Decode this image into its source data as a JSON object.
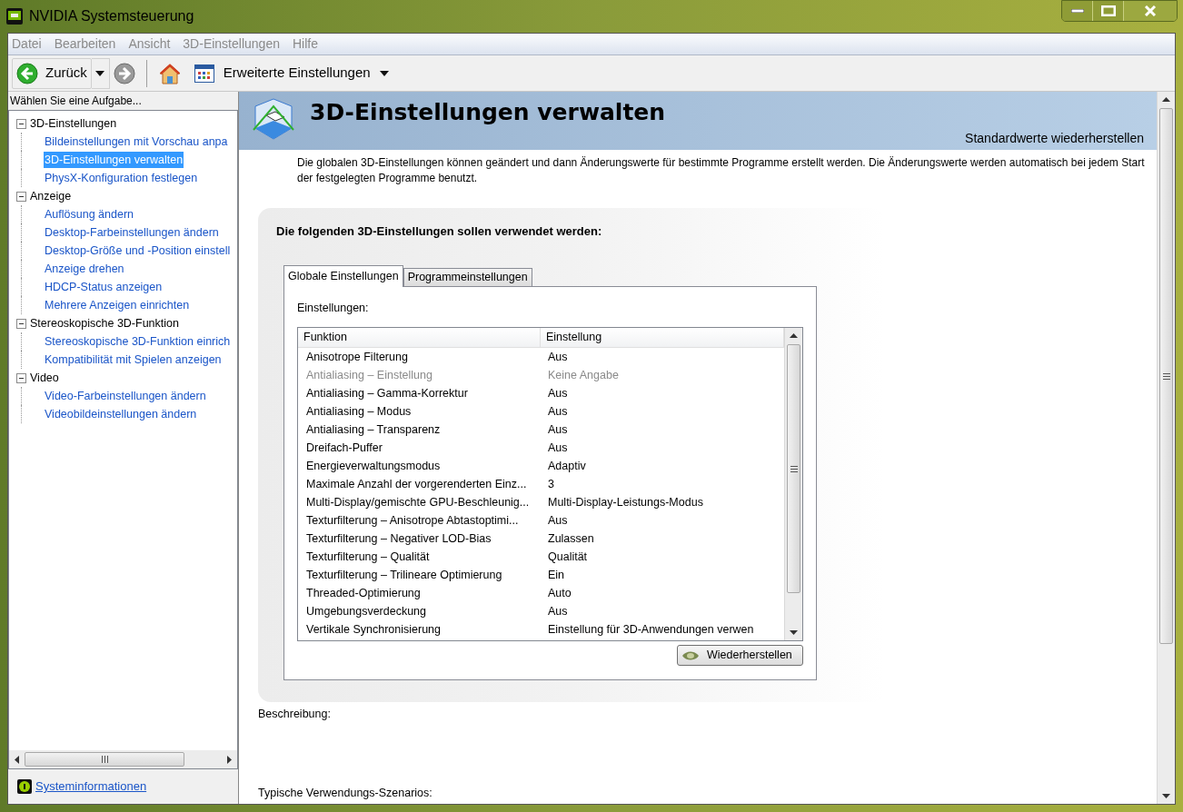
{
  "window": {
    "title": "NVIDIA Systemsteuerung"
  },
  "menu": [
    "Datei",
    "Bearbeiten",
    "Ansicht",
    "3D-Einstellungen",
    "Hilfe"
  ],
  "toolbar": {
    "back": "Zurück",
    "advanced": "Erweiterte Einstellungen"
  },
  "sidebar": {
    "heading": "Wählen Sie eine Aufgabe...",
    "tree": [
      {
        "label": "3D-Einstellungen",
        "expanded": true,
        "children": [
          {
            "label": "Bildeinstellungen mit Vorschau anpa",
            "selected": false
          },
          {
            "label": "3D-Einstellungen verwalten",
            "selected": true
          },
          {
            "label": "PhysX-Konfiguration festlegen",
            "selected": false
          }
        ]
      },
      {
        "label": "Anzeige",
        "expanded": true,
        "children": [
          {
            "label": "Auflösung ändern",
            "selected": false
          },
          {
            "label": "Desktop-Farbeinstellungen ändern",
            "selected": false
          },
          {
            "label": "Desktop-Größe und -Position einstell",
            "selected": false
          },
          {
            "label": "Anzeige drehen",
            "selected": false
          },
          {
            "label": "HDCP-Status anzeigen",
            "selected": false
          },
          {
            "label": "Mehrere Anzeigen einrichten",
            "selected": false
          }
        ]
      },
      {
        "label": "Stereoskopische 3D-Funktion",
        "expanded": true,
        "children": [
          {
            "label": "Stereoskopische 3D-Funktion einrich",
            "selected": false
          },
          {
            "label": "Kompatibilität mit Spielen anzeigen",
            "selected": false
          }
        ]
      },
      {
        "label": "Video",
        "expanded": true,
        "children": [
          {
            "label": "Video-Farbeinstellungen ändern",
            "selected": false
          },
          {
            "label": "Videobildeinstellungen ändern",
            "selected": false
          }
        ]
      }
    ],
    "footer_link": "Systeminformationen"
  },
  "content": {
    "title": "3D-Einstellungen verwalten",
    "restore_link": "Standardwerte wiederherstellen",
    "description": "Die globalen 3D-Einstellungen können geändert und dann Änderungswerte für bestimmte Programme erstellt werden. Die Änderungswerte werden automatisch bei jedem Start der festgelegten Programme benutzt.",
    "panel": {
      "heading": "Die folgenden 3D-Einstellungen sollen verwendet werden:",
      "tabs": [
        {
          "label": "Globale Einstellungen",
          "selected": true
        },
        {
          "label": "Programmeinstellungen",
          "selected": false
        }
      ],
      "settings_label": "Einstellungen:",
      "table": {
        "columns": [
          "Funktion",
          "Einstellung"
        ],
        "rows": [
          {
            "function": "Anisotrope Filterung",
            "setting": "Aus",
            "disabled": false
          },
          {
            "function": "Antialiasing – Einstellung",
            "setting": "Keine Angabe",
            "disabled": true
          },
          {
            "function": "Antialiasing – Gamma-Korrektur",
            "setting": "Aus",
            "disabled": false
          },
          {
            "function": "Antialiasing – Modus",
            "setting": "Aus",
            "disabled": false
          },
          {
            "function": "Antialiasing – Transparenz",
            "setting": "Aus",
            "disabled": false
          },
          {
            "function": "Dreifach-Puffer",
            "setting": "Aus",
            "disabled": false
          },
          {
            "function": "Energieverwaltungsmodus",
            "setting": "Adaptiv",
            "disabled": false
          },
          {
            "function": "Maximale Anzahl der vorgerenderten Einz...",
            "setting": "3",
            "disabled": false
          },
          {
            "function": "Multi-Display/gemischte GPU-Beschleunig...",
            "setting": "Multi-Display-Leistungs-Modus",
            "disabled": false
          },
          {
            "function": "Texturfilterung – Anisotrope Abtastoptimi...",
            "setting": "Aus",
            "disabled": false
          },
          {
            "function": "Texturfilterung – Negativer LOD-Bias",
            "setting": "Zulassen",
            "disabled": false
          },
          {
            "function": "Texturfilterung – Qualität",
            "setting": "Qualität",
            "disabled": false
          },
          {
            "function": "Texturfilterung – Trilineare Optimierung",
            "setting": "Ein",
            "disabled": false
          },
          {
            "function": "Threaded-Optimierung",
            "setting": "Auto",
            "disabled": false
          },
          {
            "function": "Umgebungsverdeckung",
            "setting": "Aus",
            "disabled": false
          },
          {
            "function": "Vertikale Synchronisierung",
            "setting": "Einstellung für 3D-Anwendungen verwen",
            "disabled": false
          }
        ]
      },
      "restore_button": "Wiederherstellen"
    },
    "description_label": "Beschreibung:",
    "scenarios_label": "Typische Verwendungs-Szenarios:"
  }
}
